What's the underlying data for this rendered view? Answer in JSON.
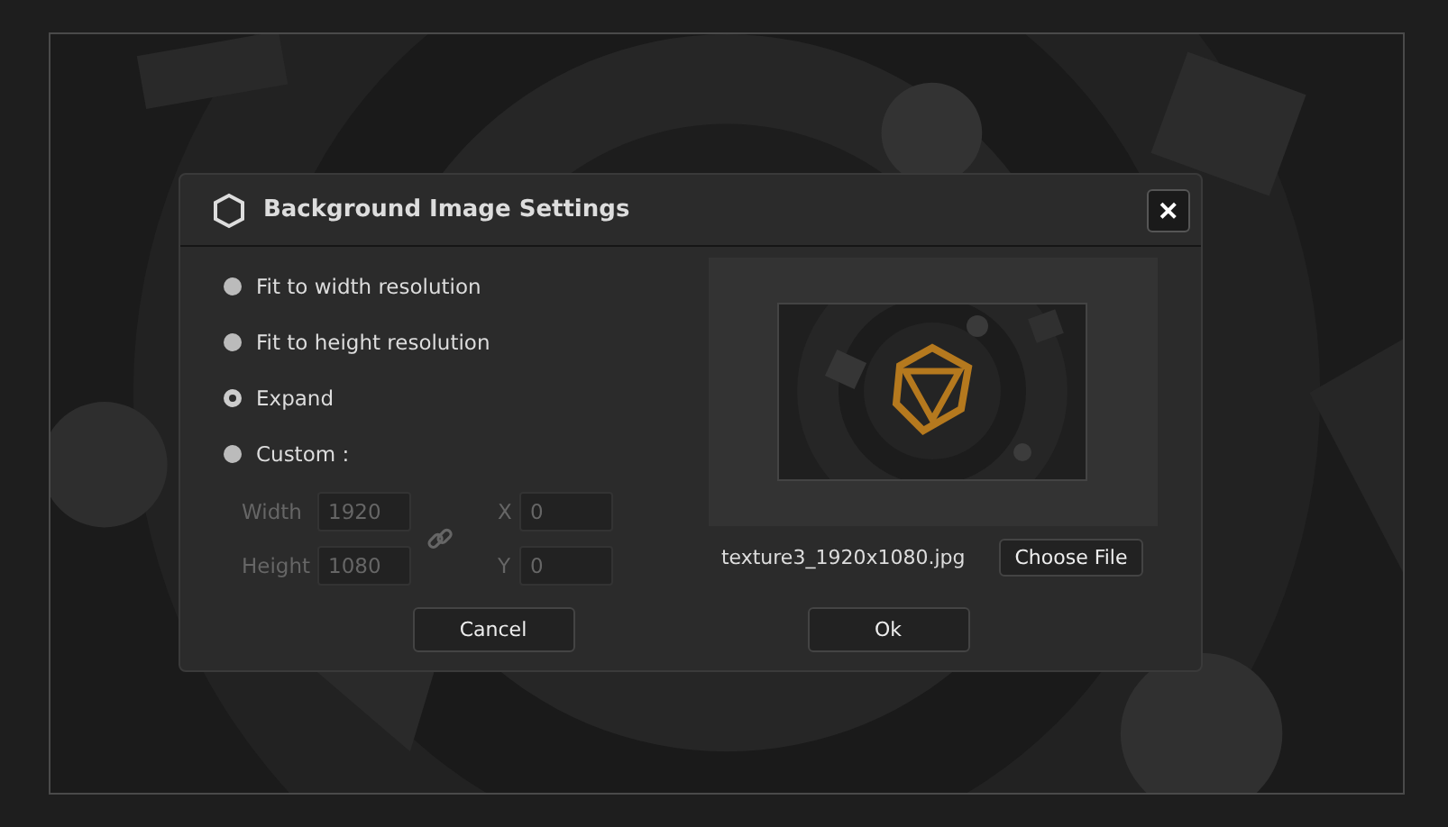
{
  "dialog": {
    "title": "Background Image Settings",
    "close": "✕",
    "options": [
      {
        "label": "Fit to width resolution",
        "selected": false
      },
      {
        "label": "Fit to height resolution",
        "selected": false
      },
      {
        "label": "Expand",
        "selected": true
      },
      {
        "label": "Custom :",
        "selected": false
      }
    ],
    "fields": [
      {
        "label": "Width",
        "value": "1920",
        "disabled": true
      },
      {
        "label": "Height",
        "value": "1080",
        "disabled": true
      },
      {
        "label": "X",
        "value": "0",
        "disabled": true
      },
      {
        "label": "Y",
        "value": "0",
        "disabled": true
      }
    ],
    "file_name": "texture3_1920x1080.jpg",
    "choose_button": "Choose File",
    "buttons": [
      "Cancel",
      "Ok"
    ]
  }
}
